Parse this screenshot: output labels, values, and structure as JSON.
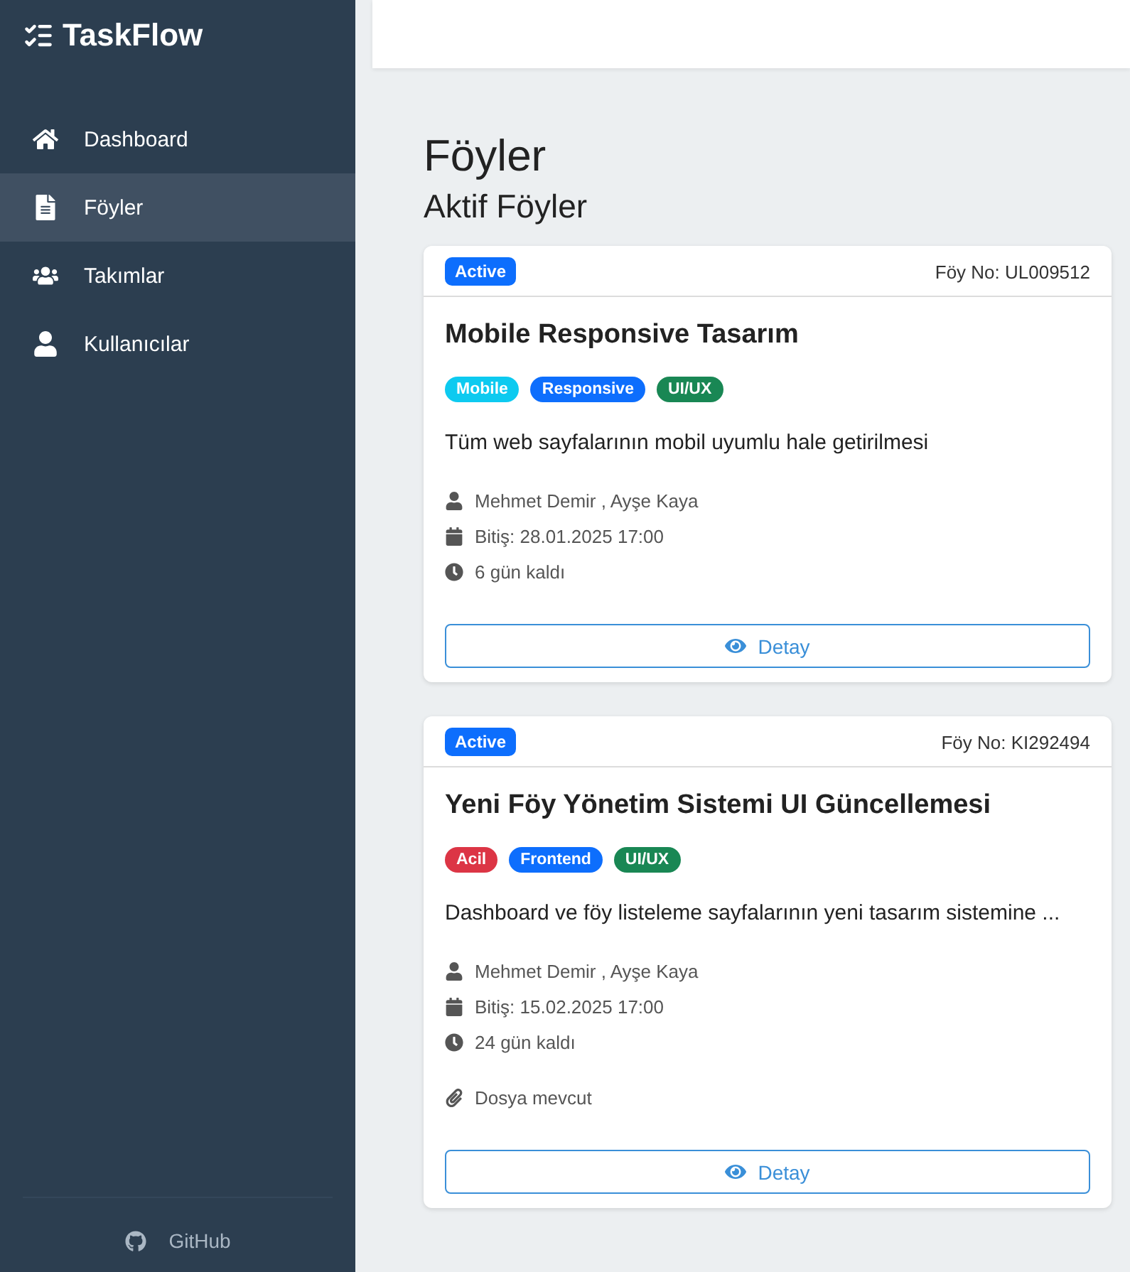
{
  "sidebar": {
    "brand": "TaskFlow",
    "items": [
      {
        "label": "Dashboard",
        "kind": "home",
        "selected": false
      },
      {
        "label": "Föyler",
        "kind": "file",
        "selected": true
      },
      {
        "label": "Takımlar",
        "kind": "team",
        "selected": false
      },
      {
        "label": "Kullanıcılar",
        "kind": "user",
        "selected": false
      }
    ],
    "footer_link": "GitHub"
  },
  "page": {
    "title": "Föyler",
    "subtitle": "Aktif Föyler"
  },
  "cards": [
    {
      "status": "Active",
      "number": "Föy No: UL009512",
      "title": "Mobile Responsive Tasarım",
      "tags": [
        {
          "label": "Mobile",
          "color": "#0dcaf0"
        },
        {
          "label": "Responsive",
          "color": "#0d6efd"
        },
        {
          "label": "UI/UX",
          "color": "#198754"
        }
      ],
      "description": "Tüm web sayfalarının mobil uyumlu hale getirilmesi",
      "meta": [
        {
          "kind": "assignees",
          "text": "Mehmet Demir , Ayşe Kaya"
        },
        {
          "kind": "due",
          "text": "Bitiş: 28.01.2025 17:00"
        },
        {
          "kind": "remaining",
          "text": "6 gün kaldı"
        }
      ],
      "button": "Detay"
    },
    {
      "status": "Active",
      "number": "Föy No: KI292494",
      "title": "Yeni Föy Yönetim Sistemi UI Güncellemesi",
      "tags": [
        {
          "label": "Acil",
          "color": "#dc3545"
        },
        {
          "label": "Frontend",
          "color": "#0d6efd"
        },
        {
          "label": "UI/UX",
          "color": "#198754"
        }
      ],
      "description": "Dashboard ve föy listeleme sayfalarının yeni tasarım sistemine ...",
      "meta": [
        {
          "kind": "assignees",
          "text": "Mehmet Demir , Ayşe Kaya"
        },
        {
          "kind": "due",
          "text": "Bitiş: 15.02.2025 17:00"
        },
        {
          "kind": "remaining",
          "text": "24 gün kaldı"
        },
        {
          "kind": "attachment",
          "text": "Dosya mevcut"
        }
      ],
      "button": "Detay"
    }
  ]
}
